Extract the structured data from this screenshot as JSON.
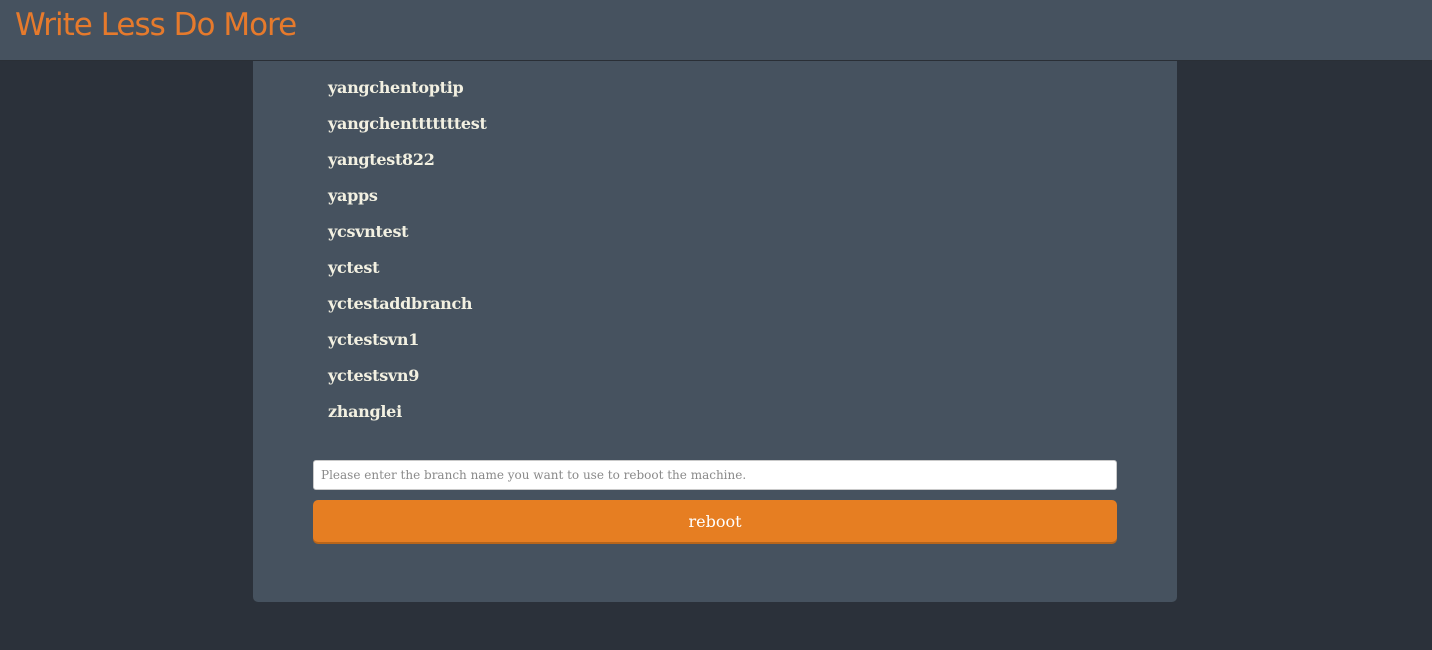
{
  "header": {
    "title": "Write Less Do More"
  },
  "branches": [
    "yangchentoptip",
    "yangchentttttttest",
    "yangtest822",
    "yapps",
    "ycsvntest",
    "yctest",
    "yctestaddbranch",
    "yctestsvn1",
    "yctestsvn9",
    "zhanglei"
  ],
  "form": {
    "branch_placeholder": "Please enter the branch name you want to use to reboot the machine.",
    "branch_value": "",
    "submit_label": "reboot"
  },
  "colors": {
    "page_background": "#2b313a",
    "panel_background": "#46525f",
    "brand": "#e67a2c",
    "button": "#e67e22",
    "list_text": "#f2f0e1"
  }
}
